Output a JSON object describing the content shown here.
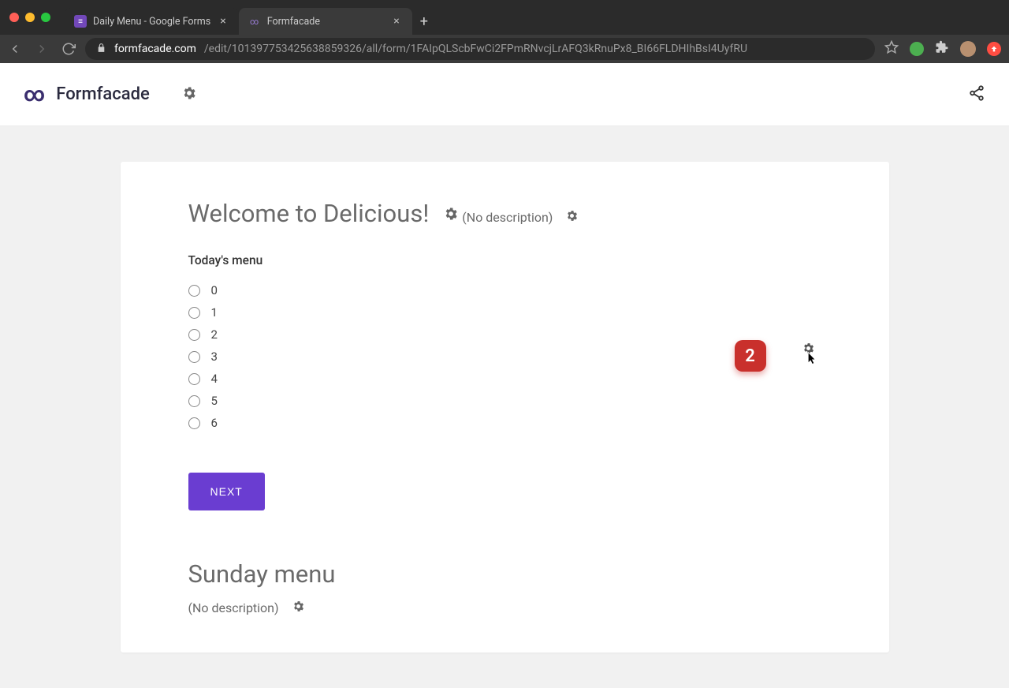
{
  "browser": {
    "tabs": [
      {
        "title": "Daily Menu - Google Forms",
        "active": false
      },
      {
        "title": "Formfacade",
        "active": true
      }
    ],
    "url_host": "formfacade.com",
    "url_path": "/edit/101397753425638859326/all/form/1FAIpQLScbFwCi2FPmRNvcjLrAFQ3kRnuPx8_BI66FLDHIhBsI4UyfRU"
  },
  "app": {
    "brand": "Formfacade"
  },
  "form": {
    "title": "Welcome to Delicious!",
    "description": "(No description)",
    "question": {
      "label": "Today's menu",
      "options": [
        "0",
        "1",
        "2",
        "3",
        "4",
        "5",
        "6"
      ]
    },
    "next_label": "NEXT",
    "badge_number": "2",
    "section2_title": "Sunday menu",
    "section2_description": "(No description)"
  }
}
